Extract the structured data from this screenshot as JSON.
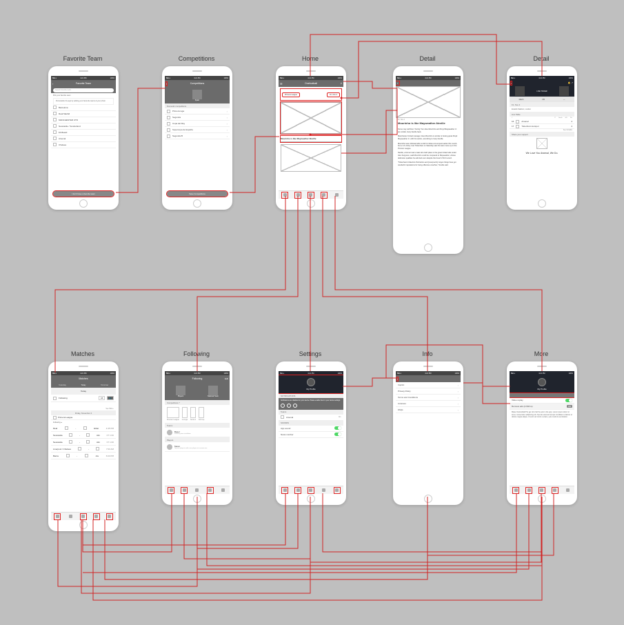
{
  "labels": {
    "favorite": "Favorite Team",
    "competitions": "Competitions",
    "home": "Home",
    "detail1": "Detail",
    "detail2": "Detail",
    "matches": "Matches",
    "following": "Following",
    "settings": "Settings",
    "info": "Info",
    "more": "More"
  },
  "status": {
    "carrier": "BELL",
    "time": "4:21 PM",
    "battery": "100%"
  },
  "tabs": [
    "Home",
    "Matches",
    "Following",
    "Settings",
    "More"
  ],
  "favorite": {
    "title": "Favorite Team",
    "search_placeholder": "Search favorite team",
    "hint1": "Pick your favorite team",
    "hint2": "Personalize the app by adding your favourite teams & your photo",
    "teams": [
      "Barcelona",
      "Real Madrid",
      "MANCHESTER UTD",
      "Newcastle / Sunderland",
      "FA Board",
      "Arsenal",
      "Chelsea"
    ],
    "cta": "I don't have a favorite team"
  },
  "competitions": {
    "title": "Competitions",
    "national_box": "Spain",
    "section": "Domestic competitions",
    "items": [
      "Primera Liga",
      "Segunda",
      "Copa del Rey",
      "Supercopa de España",
      "Segunda B"
    ],
    "cta": "Save Competitions"
  },
  "home": {
    "title": "Onefootball",
    "left": "☰",
    "right": "⚲",
    "league_tag": "Primera League",
    "date_tag": "Fri, Nov 4",
    "headline": "Mourinho is like Mayweather-Neville"
  },
  "detail_article": {
    "date": "Fri, Nov 4",
    "title": "Mourinho is like Mayweather-Neville",
    "p1": "Some may call them \"boring\" but Jose Mourinho and Floyd Mayweather Jr. are similar, Gary Neville feels.",
    "p2": "Manchester United manager Jose Mourinho is similar to boxing great Floyd Mayweather Jr. with his tactics, according to Gary Neville.",
    "p3": "Mourinho was criticised after a dull 0-0 draw at Liverpool earlier this month, but a 1-0 victory over Tottenham on Saturday saw his team move up to the Premier League.",
    "p4": "Neville, a former team-mate who held place in the great United side under Alex Ferguson, said Mourinho could be compared to Mayweather, whose defensive qualities he admired even despite the boxer's 50-0 record.",
    "p5": "\"Tottenham's Mauricio Pochettino and [Liverpool's] Jurgen Klopp have got wonderful reputations for being offensive coaches,\" Neville said."
  },
  "detail_match": {
    "score_label": "LIVE TICKER",
    "fixture": "Fri, Nov 4",
    "stadium": "Estadio Stadium, London",
    "section": "Live Table",
    "cols": [
      "#",
      "",
      "P",
      "Goals",
      "GD",
      "Pts"
    ],
    "rows": [
      {
        "pos": "16",
        "team": "Arsenal",
        "p": "4",
        "g": "-",
        "gd": "-",
        "pts": "-"
      },
      {
        "pos": "17",
        "team": "Tottenham Hotspur",
        "p": "4",
        "g": "-",
        "gd": "-",
        "pts": "-"
      }
    ],
    "tail": "See full table",
    "share": "Share your support",
    "footer": "We Love You Arsenal, We Do."
  },
  "matches": {
    "title": "Matches",
    "tabs": [
      "Yesterday",
      "Today",
      "Tomorrow"
    ],
    "filter": "Today",
    "following_lbl": "Following",
    "all_lbl": "All",
    "date_header": "Friday, November 4",
    "league_header": "Primera League",
    "see_table": "See Table ›",
    "rows": [
      {
        "home": "Real",
        "away": "Eibar",
        "t": "4:45 PM"
      },
      {
        "home": "Newcastle",
        "away": "Alm",
        "t": "FT 1:00"
      },
      {
        "home": "Newcastle",
        "away": "Alm",
        "t": "FT 1:00"
      },
      {
        "home": "Liverpool / Chelsea",
        "away": "",
        "t": "7:00 AM"
      },
      {
        "home": "Barca",
        "away": "Juv",
        "t": "6:00 PM"
      }
    ]
  },
  "following": {
    "title": "Following",
    "tab_a": "Players",
    "tab_b": "National Team",
    "section_comp": "Competitions 7",
    "comp_tiles": [
      "Premier League",
      "La Liga",
      "Serie A",
      "FA Cup"
    ],
    "section_teams": "Teams",
    "team1": "Basel",
    "team1_sub": "Following since installation",
    "section_players": "Players",
    "player1": "Messi",
    "player1_sub": "Tap on a player to add a new player or to remove one",
    "edit": "Edit"
  },
  "settings": {
    "title": "Settings",
    "profile": "My Profile",
    "notif_h": "NOTIFICATIONS",
    "notif_body": "Notifications are disabled on your device. Please enable them in your device settings.",
    "sect_teams": "Teams",
    "team_row": "Arsenal",
    "sect_sounds": "SOUNDS",
    "row_sound": "App sound",
    "row_news": "News number"
  },
  "info": {
    "items": [
      "Imprint",
      "Privacy Policy",
      "Terms and Conditions",
      "Licenses",
      "FAQs"
    ]
  },
  "more": {
    "title": "More",
    "profile": "My Profile",
    "video_h": "Video replay",
    "ad_h": "Remove ads (2.99/mo)",
    "ad_badge": "AD",
    "ad_body": "Make Onefootball Pro get rid of all the ads in the app. Lorem ipsum dolor sit amet, consectetur adipiscing elit. Sed do eiusmod tempor incididunt ut labore et dolore magna aliqua. Ut enim ad minim veniam, quis nostrud exercitation."
  }
}
